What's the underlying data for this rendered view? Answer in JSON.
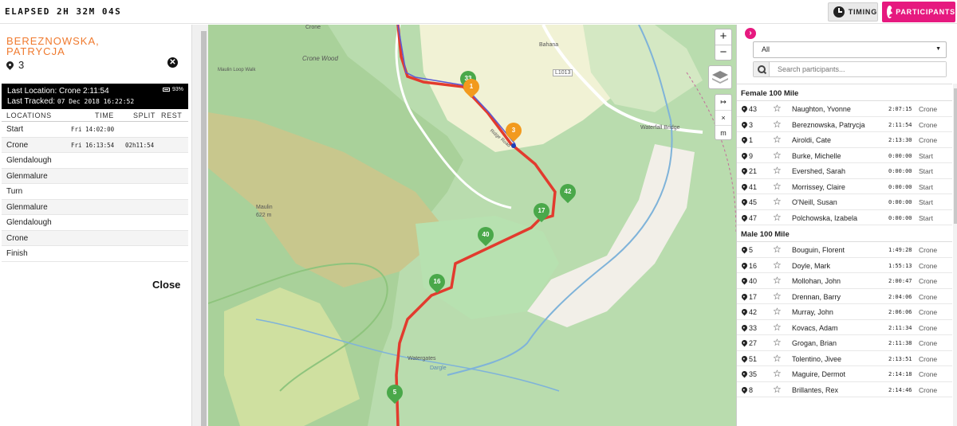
{
  "topbar": {
    "elapsed": "ELAPSED 2H 32M 04S",
    "timing_label": "TIMING",
    "participants_label": "PARTICIPANTS",
    "accent_color": "#e6197f"
  },
  "runner": {
    "name": "BEREZNOWSKA, PATRYCJA",
    "bib": "3",
    "last_location": "Last Location: Crone  2:11:54",
    "last_tracked_label": "Last Tracked:",
    "last_tracked_value": "07 Dec 2018 16:22:52",
    "battery": "93%",
    "name_color": "#f07a2e"
  },
  "locations": {
    "headers": {
      "location": "LOCATIONS",
      "time": "TIME",
      "split": "SPLIT",
      "rest": "REST"
    },
    "rows": [
      {
        "name": "Start",
        "time": "Fri 14:02:00",
        "split": ""
      },
      {
        "name": "Crone",
        "time": "Fri 16:13:54",
        "split": "02h11:54"
      },
      {
        "name": "Glendalough",
        "time": "",
        "split": ""
      },
      {
        "name": "Glenmalure",
        "time": "",
        "split": ""
      },
      {
        "name": "Turn",
        "time": "",
        "split": ""
      },
      {
        "name": "Glenmalure",
        "time": "",
        "split": ""
      },
      {
        "name": "Glendalough",
        "time": "",
        "split": ""
      },
      {
        "name": "Crone",
        "time": "",
        "split": ""
      },
      {
        "name": "Finish",
        "time": "",
        "split": ""
      }
    ],
    "close_label": "Close"
  },
  "map": {
    "labels": {
      "crone_top": "Crone",
      "crone_wood": "Crone Wood",
      "bahana": "Bahana",
      "l1013": "L1013",
      "waterfall_bridge": "Waterfall Bridge",
      "maulin": "Maulin",
      "maulin_height": "622 m",
      "watergates": "Watergates",
      "dargle": "Dargle",
      "maulin_loop": "Maulin Loop Walk",
      "ridge_road": "Ridge Road"
    },
    "zoom_in": "+",
    "zoom_out": "−",
    "measure_items": [
      "↦",
      "×",
      "m"
    ],
    "markers": [
      {
        "label": "33",
        "color": "green"
      },
      {
        "label": "1",
        "color": "orange"
      },
      {
        "label": "3",
        "color": "orange"
      },
      {
        "label": "42",
        "color": "green"
      },
      {
        "label": "17",
        "color": "green"
      },
      {
        "label": "40",
        "color": "green"
      },
      {
        "label": "16",
        "color": "green"
      },
      {
        "label": "5",
        "color": "green"
      }
    ],
    "route_color": "#e23b2e",
    "track_color": "#5b5bd6"
  },
  "participants": {
    "filter_value": "All",
    "search_placeholder": "Search participants...",
    "groups": [
      {
        "title": "Female 100 Mile",
        "rows": [
          {
            "bib": "43",
            "name": "Naughton, Yvonne",
            "time": "2:07:15",
            "loc": "Crone"
          },
          {
            "bib": "3",
            "name": "Bereznowska, Patrycja",
            "time": "2:11:54",
            "loc": "Crone"
          },
          {
            "bib": "1",
            "name": "Airoldi, Cate",
            "time": "2:13:30",
            "loc": "Crone"
          },
          {
            "bib": "9",
            "name": "Burke, Michelle",
            "time": "0:00:00",
            "loc": "Start"
          },
          {
            "bib": "21",
            "name": "Evershed, Sarah",
            "time": "0:00:00",
            "loc": "Start"
          },
          {
            "bib": "41",
            "name": "Morrissey, Claire",
            "time": "0:00:00",
            "loc": "Start"
          },
          {
            "bib": "45",
            "name": "O'Neill, Susan",
            "time": "0:00:00",
            "loc": "Start"
          },
          {
            "bib": "47",
            "name": "Polchowska, Izabela",
            "time": "0:00:00",
            "loc": "Start"
          }
        ]
      },
      {
        "title": "Male 100 Mile",
        "rows": [
          {
            "bib": "5",
            "name": "Bouguin, Florent",
            "time": "1:49:28",
            "loc": "Crone"
          },
          {
            "bib": "16",
            "name": "Doyle, Mark",
            "time": "1:55:13",
            "loc": "Crone"
          },
          {
            "bib": "40",
            "name": "Mollohan, John",
            "time": "2:00:47",
            "loc": "Crone"
          },
          {
            "bib": "17",
            "name": "Drennan, Barry",
            "time": "2:04:06",
            "loc": "Crone"
          },
          {
            "bib": "42",
            "name": "Murray, John",
            "time": "2:06:06",
            "loc": "Crone"
          },
          {
            "bib": "33",
            "name": "Kovacs, Adam",
            "time": "2:11:34",
            "loc": "Crone"
          },
          {
            "bib": "27",
            "name": "Grogan, Brian",
            "time": "2:11:38",
            "loc": "Crone"
          },
          {
            "bib": "51",
            "name": "Tolentino, Jivee",
            "time": "2:13:51",
            "loc": "Crone"
          },
          {
            "bib": "35",
            "name": "Maguire, Dermot",
            "time": "2:14:18",
            "loc": "Crone"
          },
          {
            "bib": "8",
            "name": "Brillantes, Rex",
            "time": "2:14:46",
            "loc": "Crone"
          }
        ]
      }
    ]
  }
}
